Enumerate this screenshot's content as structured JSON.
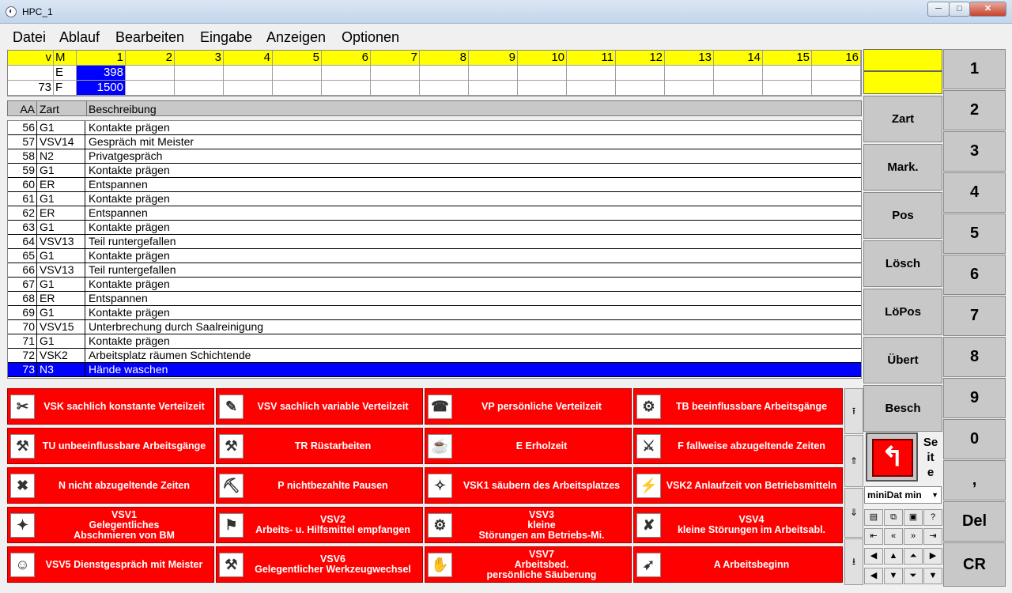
{
  "window": {
    "title": "HPC_1"
  },
  "menu": [
    "Datei",
    "Ablauf",
    "Bearbeiten",
    "Eingabe",
    "Anzeigen",
    "Optionen"
  ],
  "grid": {
    "headers": [
      "v",
      "M",
      "1",
      "2",
      "3",
      "4",
      "5",
      "6",
      "7",
      "8",
      "9",
      "10",
      "11",
      "12",
      "13",
      "14",
      "15",
      "16"
    ],
    "row1": {
      "v": "",
      "m": "E",
      "c1": "398"
    },
    "row2": {
      "v": "73",
      "m": "F",
      "c1": "1500"
    }
  },
  "list": {
    "headers": {
      "aa": "AA",
      "zart": "Zart",
      "desc": "Beschreibung"
    },
    "rows": [
      {
        "aa": "56",
        "zart": "G1",
        "desc": "Kontakte prägen"
      },
      {
        "aa": "57",
        "zart": "VSV14",
        "desc": "Gespräch mit Meister"
      },
      {
        "aa": "58",
        "zart": "N2",
        "desc": "Privatgespräch"
      },
      {
        "aa": "59",
        "zart": "G1",
        "desc": "Kontakte prägen"
      },
      {
        "aa": "60",
        "zart": "ER",
        "desc": "Entspannen"
      },
      {
        "aa": "61",
        "zart": "G1",
        "desc": "Kontakte prägen"
      },
      {
        "aa": "62",
        "zart": "ER",
        "desc": "Entspannen"
      },
      {
        "aa": "63",
        "zart": "G1",
        "desc": "Kontakte prägen"
      },
      {
        "aa": "64",
        "zart": "VSV13",
        "desc": "Teil runtergefallen"
      },
      {
        "aa": "65",
        "zart": "G1",
        "desc": "Kontakte prägen"
      },
      {
        "aa": "66",
        "zart": "VSV13",
        "desc": "Teil runtergefallen"
      },
      {
        "aa": "67",
        "zart": "G1",
        "desc": "Kontakte prägen"
      },
      {
        "aa": "68",
        "zart": "ER",
        "desc": "Entspannen"
      },
      {
        "aa": "69",
        "zart": "G1",
        "desc": "Kontakte prägen"
      },
      {
        "aa": "70",
        "zart": "VSV15",
        "desc": "Unterbrechung durch Saalreinigung"
      },
      {
        "aa": "71",
        "zart": "G1",
        "desc": "Kontakte prägen"
      },
      {
        "aa": "72",
        "zart": "VSK2",
        "desc": "Arbeitsplatz räumen Schichtende"
      },
      {
        "aa": "73",
        "zart": "N3",
        "desc": "Hände waschen"
      }
    ]
  },
  "categories": [
    [
      "VSK sachlich konstante Verteilzeit",
      "VSV sachlich variable Verteilzeit",
      "VP persönliche Verteilzeit",
      "TB beeinflussbare Arbeitsgänge"
    ],
    [
      "TU unbeeinflussbare Arbeitsgänge",
      "TR Rüstarbeiten",
      "E Erholzeit",
      "F fallweise abzugeltende Zeiten"
    ],
    [
      "N nicht abzugeltende Zeiten",
      "P nichtbezahlte Pausen",
      "VSK1 säubern des Arbeitsplatzes",
      "VSK2 Anlaufzeit von Betriebsmitteln"
    ],
    [
      "VSV1\nGelegentliches\nAbschmieren von BM",
      "VSV2\nArbeits- u. Hilfsmittel empfangen",
      "VSV3\nkleine\nStörungen am Betriebs-Mi.",
      "VSV4\nkleine Störungen im Arbeitsabl."
    ],
    [
      "VSV5 Dienstgespräch mit Meister",
      "VSV6\nGelegentlicher Werkzeugwechsel",
      "VSV7\nArbeitsbed.\npersönliche Säuberung",
      "A Arbeitsbeginn"
    ]
  ],
  "side": [
    "Zart",
    "Mark.",
    "Pos",
    "Lösch",
    "LöPos",
    "Übert",
    "Besch"
  ],
  "numpad": [
    "1",
    "2",
    "3",
    "4",
    "5",
    "6",
    "7",
    "8",
    "9",
    "0",
    ",",
    "Del",
    "CR"
  ],
  "seite": [
    "Se",
    "it",
    "e"
  ],
  "dropdown": {
    "value": "miniDat min"
  },
  "colors": {
    "highlight": "#0000ff",
    "header": "#ffff00",
    "category": "#ff0000"
  }
}
